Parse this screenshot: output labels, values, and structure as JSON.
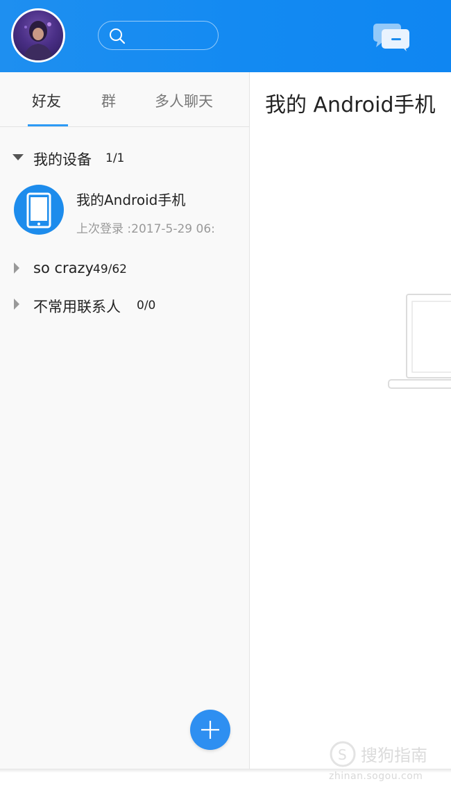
{
  "header": {
    "search_placeholder": "",
    "colors": {
      "bar": "#138af2",
      "accent": "#2d9af5"
    }
  },
  "tabs": [
    "好友",
    "群",
    "多人聊天"
  ],
  "groups": [
    {
      "name": "我的设备",
      "count": "1/1",
      "expanded": true
    },
    {
      "name": "so crazy",
      "count": "49/62",
      "expanded": false
    },
    {
      "name": "不常用联系人",
      "count": "0/0",
      "expanded": false
    }
  ],
  "contact": {
    "name": "我的Android手机",
    "status": "上次登录 :2017-5-29 06:"
  },
  "main": {
    "title": "我的 Android手机"
  },
  "watermark": {
    "text": "搜狗指南",
    "sub": "zhinan.sogou.com"
  },
  "icons": {
    "avatar": "user-avatar",
    "search": "search-icon",
    "messages": "chat-bubbles-icon",
    "device": "phone-device-icon",
    "add": "plus-icon",
    "empty_state": "laptop-illustration"
  }
}
